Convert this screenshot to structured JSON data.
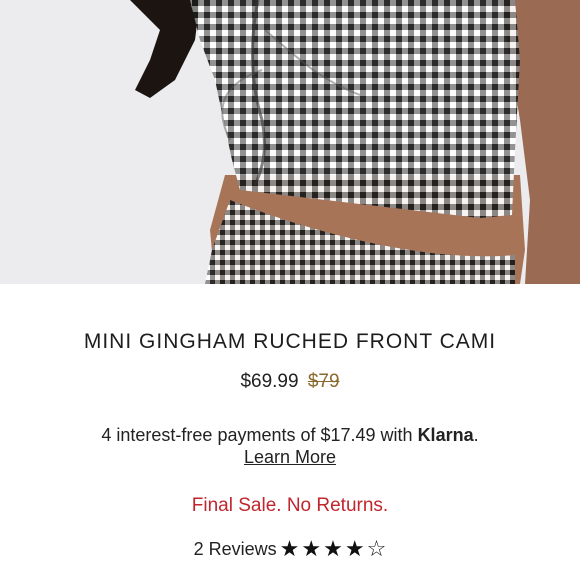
{
  "product": {
    "title": "MINI GINGHAM RUCHED FRONT CAMI",
    "price_sale": "$69.99",
    "price_original": "$79",
    "klarna_prefix": "4 interest-free payments of $17.49 with ",
    "klarna_brand": "Klarna",
    "klarna_suffix": ".",
    "learn_more": "Learn More",
    "final_sale": "Final Sale. No Returns.",
    "reviews_label": "2 Reviews",
    "rating": 4,
    "rating_max": 5
  },
  "colors": {
    "sale_note": "#c0262d",
    "original_price": "#8a6a2e",
    "gingham_dark": "#222222",
    "background": "#ececee"
  },
  "image": {
    "subject": "gingham-cami-product-photo"
  }
}
